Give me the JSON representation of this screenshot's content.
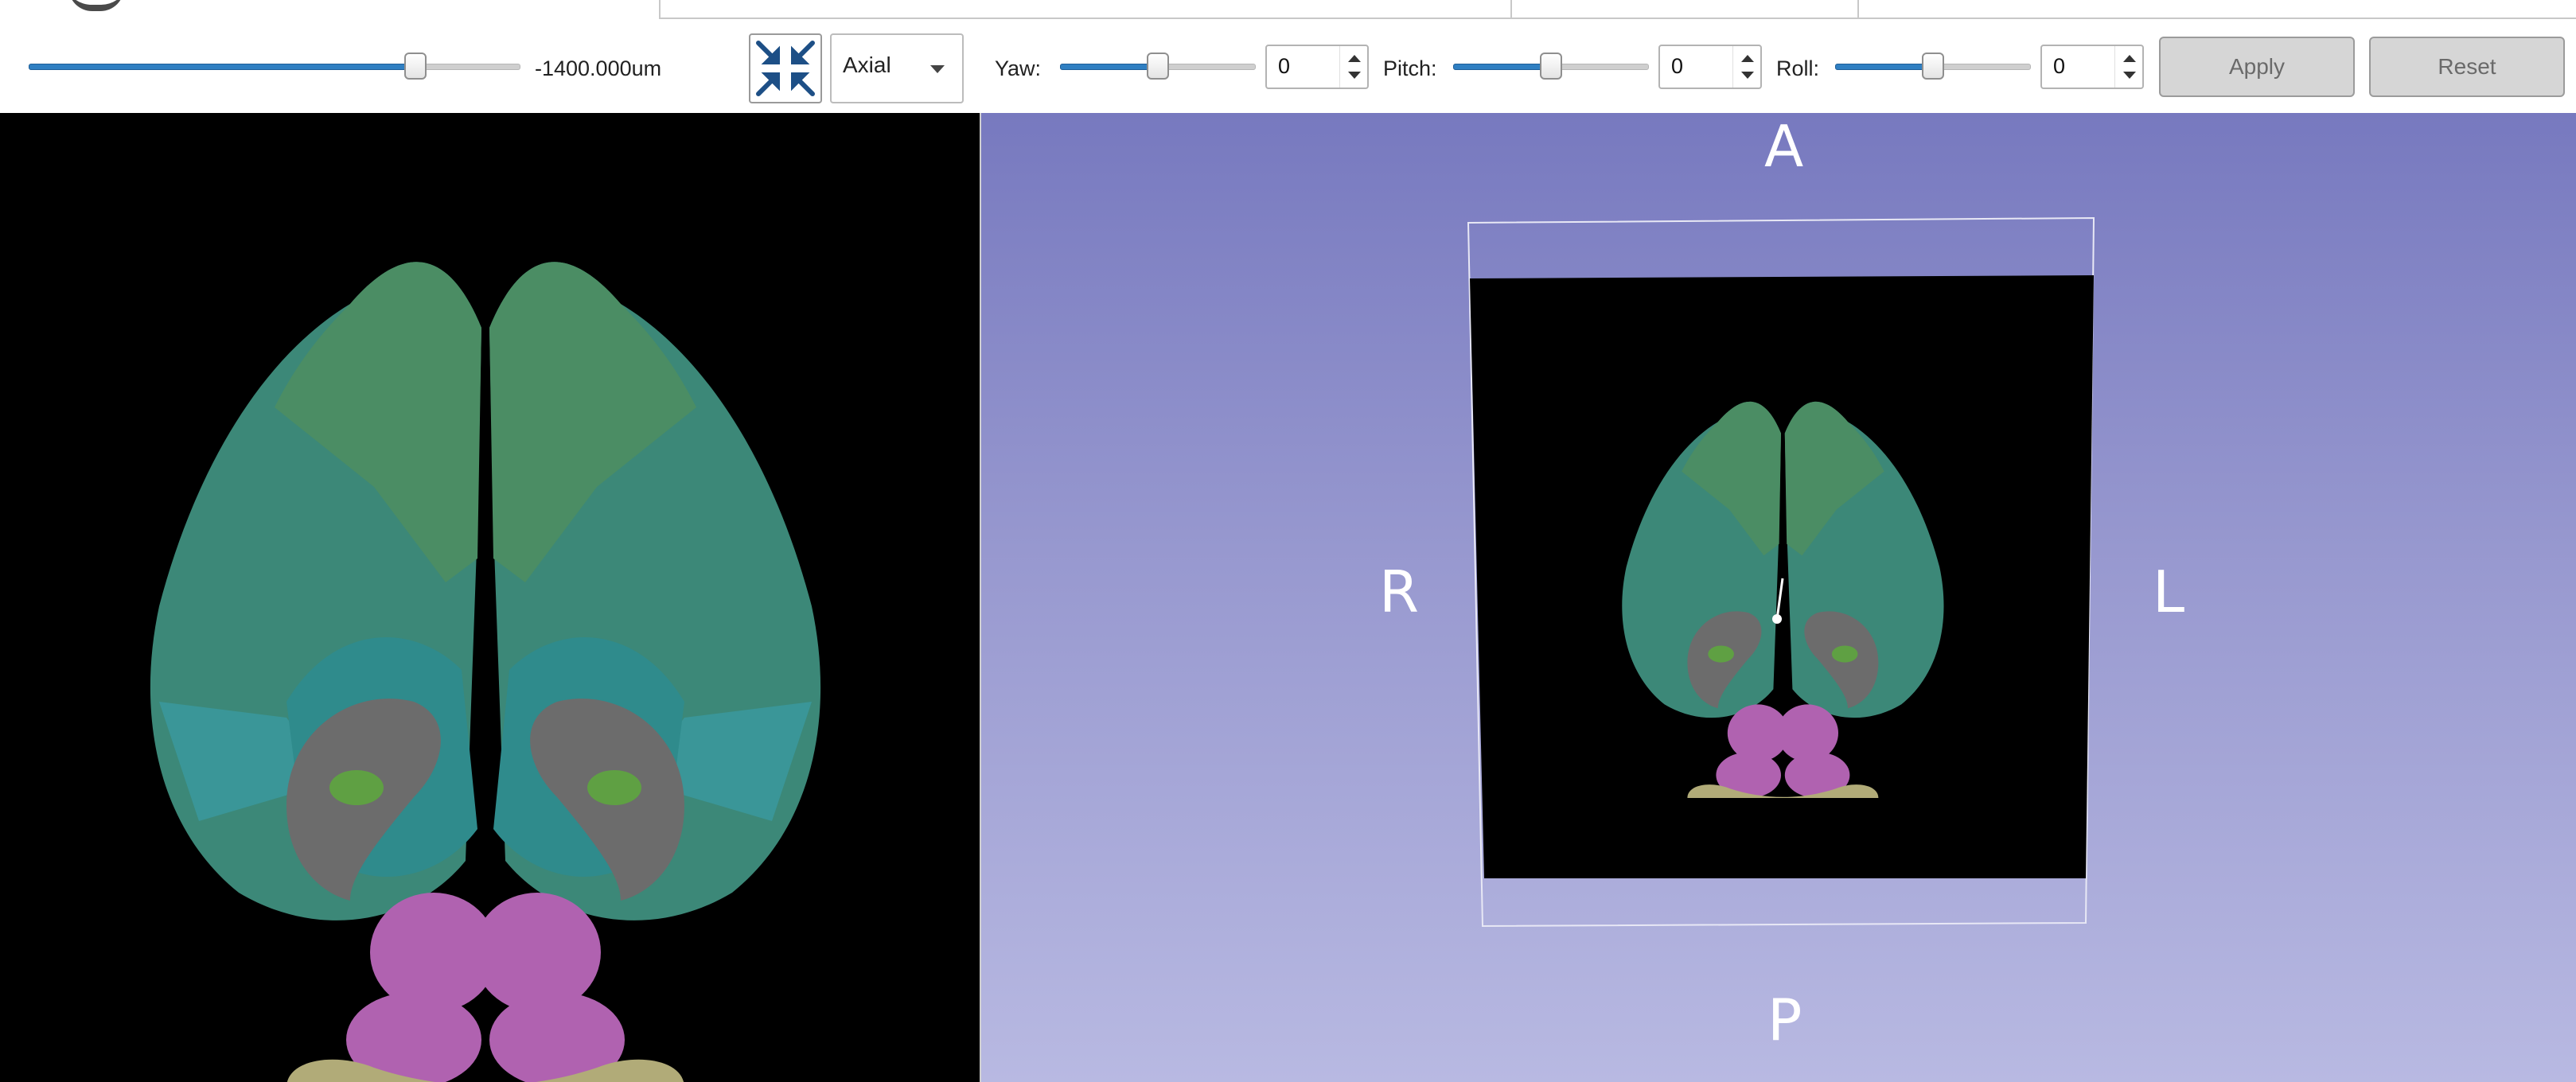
{
  "toolbar": {
    "offset_slider": {
      "fraction": 0.8
    },
    "offset_value": "-1400.000um",
    "view_select": {
      "value": "Axial"
    },
    "yaw": {
      "label": "Yaw:",
      "slider_fraction": 0.5,
      "value": "0"
    },
    "pitch": {
      "label": "Pitch:",
      "slider_fraction": 0.5,
      "value": "0"
    },
    "roll": {
      "label": "Roll:",
      "slider_fraction": 0.5,
      "value": "0"
    },
    "apply_label": "Apply",
    "reset_label": "Reset"
  },
  "view3d": {
    "orientation": {
      "anterior": "A",
      "posterior": "P",
      "right": "R",
      "left": "L"
    }
  },
  "icons": {
    "fit": "fit-to-window-icon",
    "dropdown": "chevron-down-icon"
  },
  "colors": {
    "slider_fill": "#2f7fc2",
    "cortex_green": "#4f8a6a",
    "cortex_teal": "#3f8f90",
    "striatum_gray": "#6f6f6f",
    "midbrain_magenta": "#b064b0",
    "cerebellum_khaki": "#b3ad7a",
    "view3d_top": "#7779bf",
    "view3d_bottom": "#b8b9e2"
  }
}
